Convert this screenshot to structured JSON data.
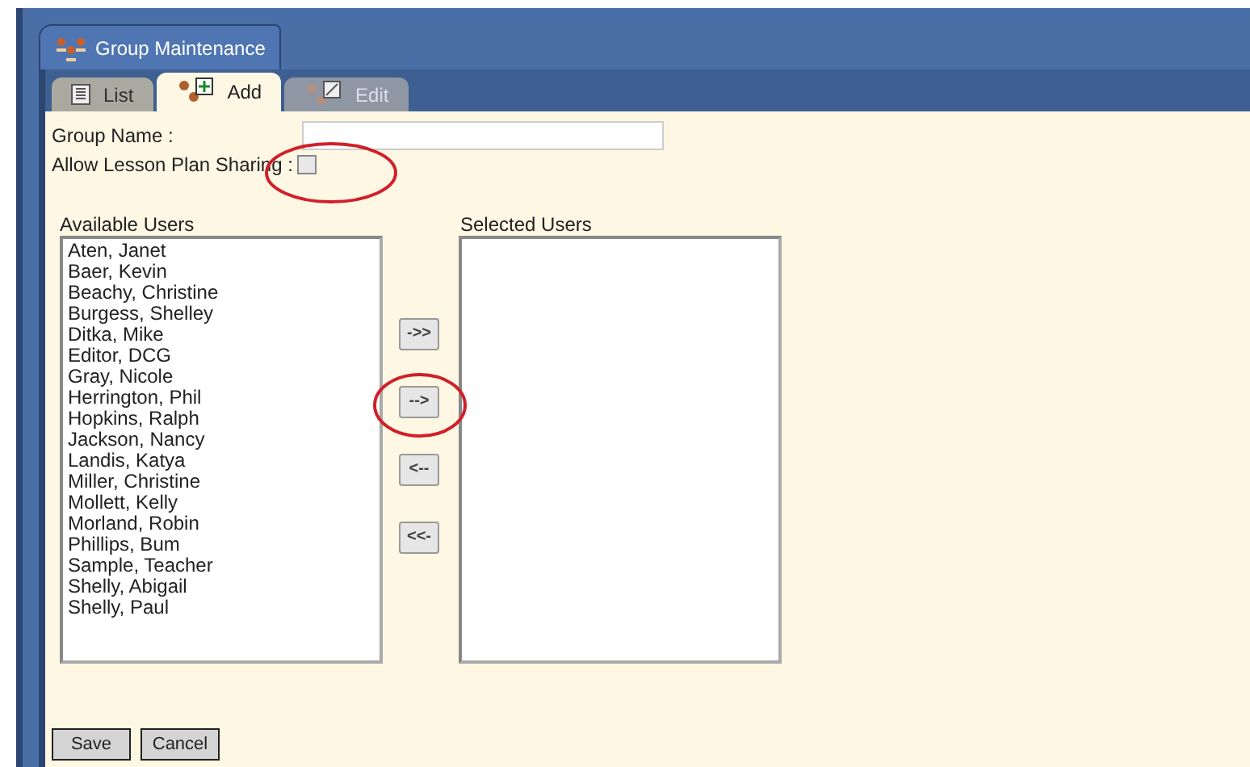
{
  "window": {
    "title": "Group Maintenance"
  },
  "tabs": [
    {
      "label": "List",
      "selected": false,
      "kind": "list"
    },
    {
      "label": "Add",
      "selected": true,
      "kind": "add"
    },
    {
      "label": "Edit",
      "selected": false,
      "kind": "edit"
    }
  ],
  "form": {
    "group_name_label": "Group Name :",
    "sharing_label": "Allow Lesson Plan Sharing :",
    "sharing_checked": false
  },
  "available_users": {
    "label": "Available Users",
    "items": [
      "Aten, Janet",
      "Baer, Kevin",
      "Beachy, Christine",
      "Burgess, Shelley",
      "Ditka, Mike",
      "Editor, DCG",
      "Gray, Nicole",
      "Herrington, Phil",
      "Hopkins, Ralph",
      "Jackson, Nancy",
      "Landis, Katya",
      "Miller, Christine",
      "Mollett, Kelly",
      "Morland, Robin",
      "Phillips, Bum",
      "Sample, Teacher",
      "Shelly, Abigail",
      "Shelly, Paul"
    ]
  },
  "move_buttons": [
    "->>",
    "-->",
    "<--",
    "<<-"
  ],
  "selected_users": {
    "label": "Selected Users"
  },
  "buttons": [
    "Save",
    "Cancel"
  ]
}
